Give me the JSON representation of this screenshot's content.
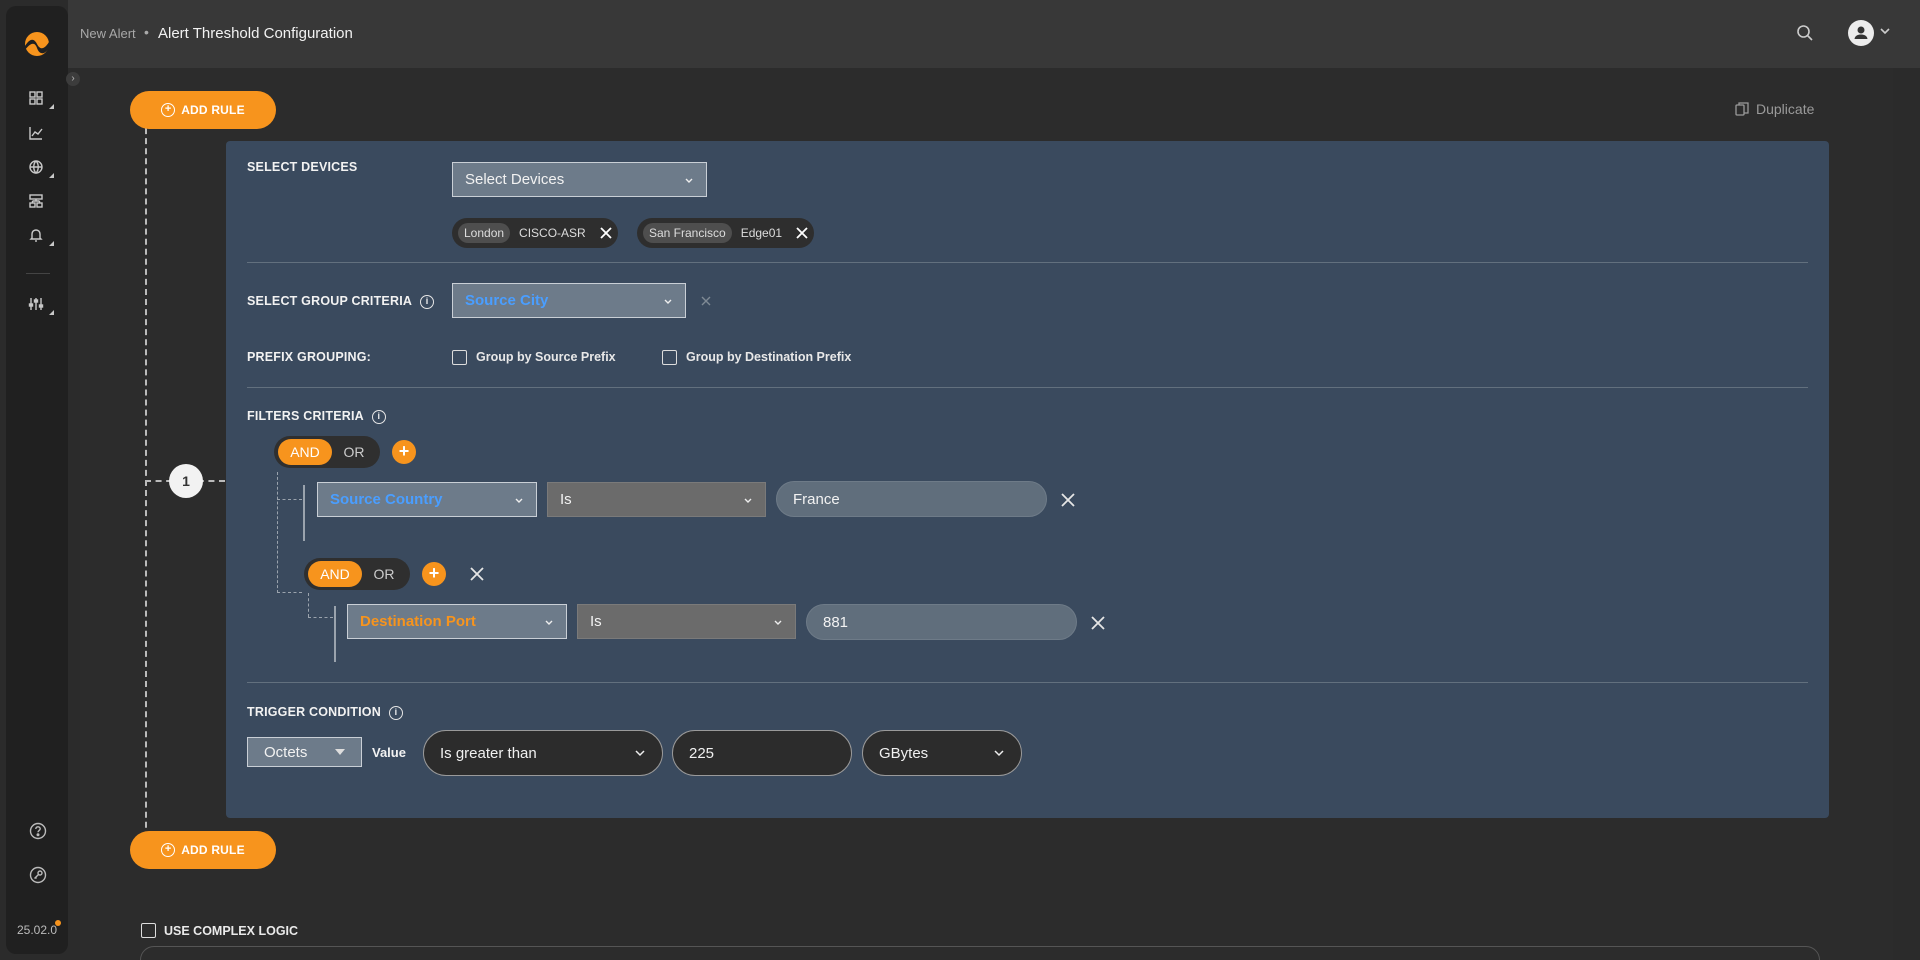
{
  "breadcrumb": {
    "parent": "New Alert",
    "separator": "•",
    "current": "Alert Threshold Configuration"
  },
  "sidebar": {
    "version": "25.02.0"
  },
  "actions": {
    "add_rule_top": "ADD RULE",
    "add_rule_bottom": "ADD RULE",
    "duplicate": "Duplicate"
  },
  "rule": {
    "number": "1",
    "devices": {
      "label": "SELECT DEVICES",
      "select_placeholder": "Select Devices",
      "chips": [
        {
          "city": "London",
          "device": "CISCO-ASR"
        },
        {
          "city": "San Francisco",
          "device": "Edge01"
        }
      ]
    },
    "group": {
      "label": "SELECT GROUP CRITERIA",
      "value": "Source City"
    },
    "prefix": {
      "label": "PREFIX GROUPING:",
      "source": "Group by Source Prefix",
      "destination": "Group by Destination Prefix"
    },
    "filters": {
      "label": "FILTERS CRITERIA",
      "and": "AND",
      "or": "OR",
      "row1": {
        "field": "Source Country",
        "operator": "Is",
        "value": "France"
      },
      "nested": {
        "and": "AND",
        "or": "OR"
      },
      "row2": {
        "field": "Destination Port",
        "operator": "Is",
        "value": "881"
      }
    },
    "trigger": {
      "label": "TRIGGER CONDITION",
      "metric": "Octets",
      "value_label": "Value",
      "comparison": "Is greater than",
      "amount": "225",
      "unit": "GBytes"
    }
  },
  "complex_logic": {
    "label": "USE COMPLEX LOGIC"
  },
  "colors": {
    "accent": "#f7941d",
    "card": "#3a4a5e",
    "blue_field": "#4a9eff"
  }
}
